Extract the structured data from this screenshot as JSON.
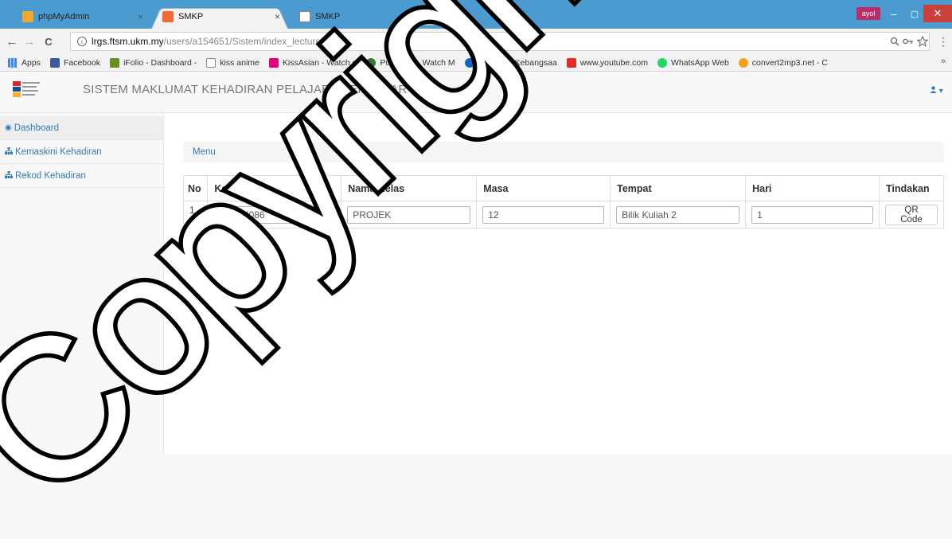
{
  "browser": {
    "tabs": [
      {
        "title": "phpMyAdmin",
        "close": "×"
      },
      {
        "title": "SMKP",
        "close": "×"
      },
      {
        "title": "SMKP",
        "close": "×"
      }
    ],
    "profile_label": "ayol",
    "window_controls": {
      "minimize": "–",
      "maximize": "▢",
      "close": "✕"
    },
    "nav": {
      "back": "←",
      "forward": "→",
      "reload": "C"
    },
    "url_host": "lrgs.ftsm.ukm.my",
    "url_path": "/users/a154651/Sistem/index_lecturer.php",
    "omnibox_icons": [
      "search-icon",
      "key-icon",
      "star-icon"
    ],
    "menu_icon": "⋮",
    "bookmarks": [
      {
        "label": "Apps",
        "color": "#4285f4"
      },
      {
        "label": "Facebook",
        "color": "#3b5998"
      },
      {
        "label": "iFolio - Dashboard -",
        "color": "#6b8e23"
      },
      {
        "label": "kiss anime",
        "color": "#9e9e9e"
      },
      {
        "label": "KissAsian - Watch d",
        "color": "#e5007e"
      },
      {
        "label": "Putlocker - Watch M",
        "color": "#2e7d32"
      },
      {
        "label": "Universiti Kebangsaa",
        "color": "#1565c0"
      },
      {
        "label": "www.youtube.com",
        "color": "#e52d27"
      },
      {
        "label": "WhatsApp Web",
        "color": "#25d366"
      },
      {
        "label": "convert2mp3.net - C",
        "color": "#f7a21b"
      }
    ],
    "bookmarks_more": "»"
  },
  "app": {
    "title": "SISTEM MAKLUMAT KEHADIRAN PELAJAR - PENGAJAR",
    "user_menu": "▾"
  },
  "sidebar": {
    "items": [
      {
        "label": "Dashboard",
        "icon": "dashboard-icon",
        "active": true
      },
      {
        "label": "Kemaskini Kehadiran",
        "icon": "sitemap-icon",
        "active": false
      },
      {
        "label": "Rekod Kehadiran",
        "icon": "sitemap-icon",
        "active": false
      }
    ]
  },
  "main": {
    "breadcrumb": "Menu",
    "table": {
      "headers": [
        "No",
        "Kelas Kod",
        "Nama Kelas",
        "Masa",
        "Tempat",
        "Hari",
        "Tindakan"
      ],
      "rows": [
        {
          "no": "1.",
          "kelas_kod": "TTTU4086",
          "nama_kelas": "PROJEK",
          "masa": "12",
          "tempat": "Bilik Kuliah 2",
          "hari": "1",
          "action": "QR Code"
        }
      ]
    }
  },
  "watermark": "Copyright",
  "colors": {
    "accent": "#337ab7",
    "tabstrip": "#4b9bd0",
    "close_button": "#c9413a"
  }
}
